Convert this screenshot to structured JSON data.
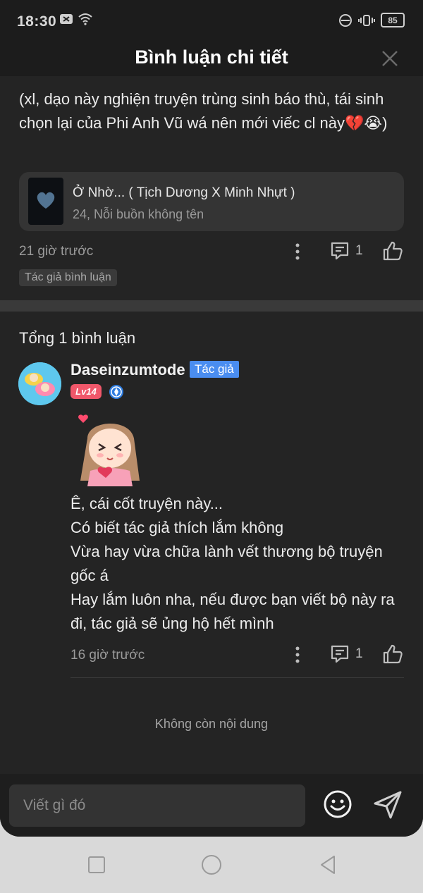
{
  "status_bar": {
    "time": "18:30",
    "battery": "85"
  },
  "header": {
    "title": "Bình luận chi tiết"
  },
  "original_comment": {
    "text": "(xl, dạo này nghiện truyện trùng sinh báo thù, tái sinh chọn lại của Phi Anh Vũ wá nên mới viếc cl này💔😭)",
    "story_card": {
      "title": "Ở Nhờ... ( Tịch Dương X Minh Nhựt )",
      "subtitle": "24, Nỗi buồn không tên"
    },
    "time": "21 giờ trước",
    "reply_count": "1",
    "tag": "Tác giả bình luận"
  },
  "replies_section": {
    "total_label": "Tổng 1 bình luận"
  },
  "reply": {
    "username": "Daseinzumtode",
    "author_badge": "Tác giả",
    "level": "Lv14",
    "lines": [
      "Ê, cái cốt truyện này...",
      "Có biết tác giả thích lắm không",
      "Vừa hay vừa chữa lành vết thương bộ truyện gốc á",
      "Hay lắm luôn nha, nếu được bạn viết bộ này ra đi, tác giả sẽ ủng hộ hết mình"
    ],
    "time": "16 giờ trước",
    "reply_count": "1"
  },
  "end_label": "Không còn nội dung",
  "input": {
    "placeholder": "Viết gì đó"
  },
  "colors": {
    "background": "#242424",
    "author_badge": "#4a8df0",
    "level_badge": "#f0576a"
  }
}
